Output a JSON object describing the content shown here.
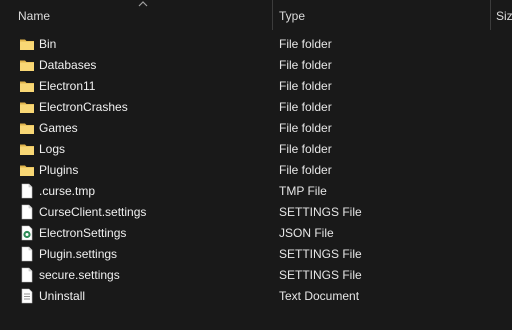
{
  "columns": {
    "name": "Name",
    "type": "Type",
    "size": "Siz"
  },
  "files": [
    {
      "name": "Bin",
      "type": "File folder",
      "icon": "folder-icon"
    },
    {
      "name": "Databases",
      "type": "File folder",
      "icon": "folder-icon"
    },
    {
      "name": "Electron11",
      "type": "File folder",
      "icon": "folder-icon"
    },
    {
      "name": "ElectronCrashes",
      "type": "File folder",
      "icon": "folder-icon"
    },
    {
      "name": "Games",
      "type": "File folder",
      "icon": "folder-icon"
    },
    {
      "name": "Logs",
      "type": "File folder",
      "icon": "folder-icon"
    },
    {
      "name": "Plugins",
      "type": "File folder",
      "icon": "folder-icon"
    },
    {
      "name": ".curse.tmp",
      "type": "TMP File",
      "icon": "file-icon"
    },
    {
      "name": "CurseClient.settings",
      "type": "SETTINGS File",
      "icon": "file-icon"
    },
    {
      "name": "ElectronSettings",
      "type": "JSON File",
      "icon": "json-file-icon"
    },
    {
      "name": "Plugin.settings",
      "type": "SETTINGS File",
      "icon": "file-icon"
    },
    {
      "name": "secure.settings",
      "type": "SETTINGS File",
      "icon": "file-icon"
    },
    {
      "name": "Uninstall",
      "type": "Text Document",
      "icon": "text-document-icon"
    }
  ],
  "colors": {
    "background": "#191919",
    "folder": "#f8d775",
    "text": "#f0f0f0"
  }
}
